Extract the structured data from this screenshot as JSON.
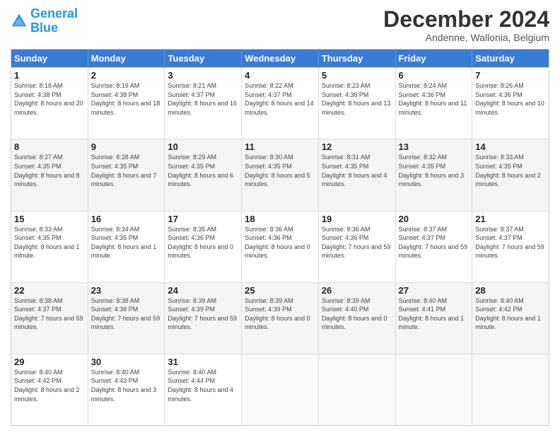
{
  "logo": {
    "line1": "General",
    "line2": "Blue"
  },
  "title": "December 2024",
  "subtitle": "Andenne, Wallonia, Belgium",
  "days_header": [
    "Sunday",
    "Monday",
    "Tuesday",
    "Wednesday",
    "Thursday",
    "Friday",
    "Saturday"
  ],
  "weeks": [
    [
      {
        "num": "1",
        "sunrise": "Sunrise: 8:18 AM",
        "sunset": "Sunset: 4:38 PM",
        "daylight": "Daylight: 8 hours and 20 minutes."
      },
      {
        "num": "2",
        "sunrise": "Sunrise: 8:19 AM",
        "sunset": "Sunset: 4:38 PM",
        "daylight": "Daylight: 8 hours and 18 minutes."
      },
      {
        "num": "3",
        "sunrise": "Sunrise: 8:21 AM",
        "sunset": "Sunset: 4:37 PM",
        "daylight": "Daylight: 8 hours and 16 minutes."
      },
      {
        "num": "4",
        "sunrise": "Sunrise: 8:22 AM",
        "sunset": "Sunset: 4:37 PM",
        "daylight": "Daylight: 8 hours and 14 minutes."
      },
      {
        "num": "5",
        "sunrise": "Sunrise: 8:23 AM",
        "sunset": "Sunset: 4:36 PM",
        "daylight": "Daylight: 8 hours and 13 minutes."
      },
      {
        "num": "6",
        "sunrise": "Sunrise: 8:24 AM",
        "sunset": "Sunset: 4:36 PM",
        "daylight": "Daylight: 8 hours and 11 minutes."
      },
      {
        "num": "7",
        "sunrise": "Sunrise: 8:26 AM",
        "sunset": "Sunset: 4:36 PM",
        "daylight": "Daylight: 8 hours and 10 minutes."
      }
    ],
    [
      {
        "num": "8",
        "sunrise": "Sunrise: 8:27 AM",
        "sunset": "Sunset: 4:35 PM",
        "daylight": "Daylight: 8 hours and 8 minutes."
      },
      {
        "num": "9",
        "sunrise": "Sunrise: 8:28 AM",
        "sunset": "Sunset: 4:35 PM",
        "daylight": "Daylight: 8 hours and 7 minutes."
      },
      {
        "num": "10",
        "sunrise": "Sunrise: 8:29 AM",
        "sunset": "Sunset: 4:35 PM",
        "daylight": "Daylight: 8 hours and 6 minutes."
      },
      {
        "num": "11",
        "sunrise": "Sunrise: 8:30 AM",
        "sunset": "Sunset: 4:35 PM",
        "daylight": "Daylight: 8 hours and 5 minutes."
      },
      {
        "num": "12",
        "sunrise": "Sunrise: 8:31 AM",
        "sunset": "Sunset: 4:35 PM",
        "daylight": "Daylight: 8 hours and 4 minutes."
      },
      {
        "num": "13",
        "sunrise": "Sunrise: 8:32 AM",
        "sunset": "Sunset: 4:35 PM",
        "daylight": "Daylight: 8 hours and 3 minutes."
      },
      {
        "num": "14",
        "sunrise": "Sunrise: 8:33 AM",
        "sunset": "Sunset: 4:35 PM",
        "daylight": "Daylight: 8 hours and 2 minutes."
      }
    ],
    [
      {
        "num": "15",
        "sunrise": "Sunrise: 8:33 AM",
        "sunset": "Sunset: 4:35 PM",
        "daylight": "Daylight: 8 hours and 1 minute."
      },
      {
        "num": "16",
        "sunrise": "Sunrise: 8:34 AM",
        "sunset": "Sunset: 4:35 PM",
        "daylight": "Daylight: 8 hours and 1 minute."
      },
      {
        "num": "17",
        "sunrise": "Sunrise: 8:35 AM",
        "sunset": "Sunset: 4:36 PM",
        "daylight": "Daylight: 8 hours and 0 minutes."
      },
      {
        "num": "18",
        "sunrise": "Sunrise: 8:36 AM",
        "sunset": "Sunset: 4:36 PM",
        "daylight": "Daylight: 8 hours and 0 minutes."
      },
      {
        "num": "19",
        "sunrise": "Sunrise: 8:36 AM",
        "sunset": "Sunset: 4:36 PM",
        "daylight": "Daylight: 7 hours and 59 minutes."
      },
      {
        "num": "20",
        "sunrise": "Sunrise: 8:37 AM",
        "sunset": "Sunset: 4:37 PM",
        "daylight": "Daylight: 7 hours and 59 minutes."
      },
      {
        "num": "21",
        "sunrise": "Sunrise: 8:37 AM",
        "sunset": "Sunset: 4:37 PM",
        "daylight": "Daylight: 7 hours and 59 minutes."
      }
    ],
    [
      {
        "num": "22",
        "sunrise": "Sunrise: 8:38 AM",
        "sunset": "Sunset: 4:37 PM",
        "daylight": "Daylight: 7 hours and 59 minutes."
      },
      {
        "num": "23",
        "sunrise": "Sunrise: 8:38 AM",
        "sunset": "Sunset: 4:38 PM",
        "daylight": "Daylight: 7 hours and 59 minutes."
      },
      {
        "num": "24",
        "sunrise": "Sunrise: 8:39 AM",
        "sunset": "Sunset: 4:39 PM",
        "daylight": "Daylight: 7 hours and 59 minutes."
      },
      {
        "num": "25",
        "sunrise": "Sunrise: 8:39 AM",
        "sunset": "Sunset: 4:39 PM",
        "daylight": "Daylight: 8 hours and 0 minutes."
      },
      {
        "num": "26",
        "sunrise": "Sunrise: 8:39 AM",
        "sunset": "Sunset: 4:40 PM",
        "daylight": "Daylight: 8 hours and 0 minutes."
      },
      {
        "num": "27",
        "sunrise": "Sunrise: 8:40 AM",
        "sunset": "Sunset: 4:41 PM",
        "daylight": "Daylight: 8 hours and 1 minute."
      },
      {
        "num": "28",
        "sunrise": "Sunrise: 8:40 AM",
        "sunset": "Sunset: 4:42 PM",
        "daylight": "Daylight: 8 hours and 1 minute."
      }
    ],
    [
      {
        "num": "29",
        "sunrise": "Sunrise: 8:40 AM",
        "sunset": "Sunset: 4:42 PM",
        "daylight": "Daylight: 8 hours and 2 minutes."
      },
      {
        "num": "30",
        "sunrise": "Sunrise: 8:40 AM",
        "sunset": "Sunset: 4:43 PM",
        "daylight": "Daylight: 8 hours and 3 minutes."
      },
      {
        "num": "31",
        "sunrise": "Sunrise: 8:40 AM",
        "sunset": "Sunset: 4:44 PM",
        "daylight": "Daylight: 8 hours and 4 minutes."
      },
      null,
      null,
      null,
      null
    ]
  ]
}
